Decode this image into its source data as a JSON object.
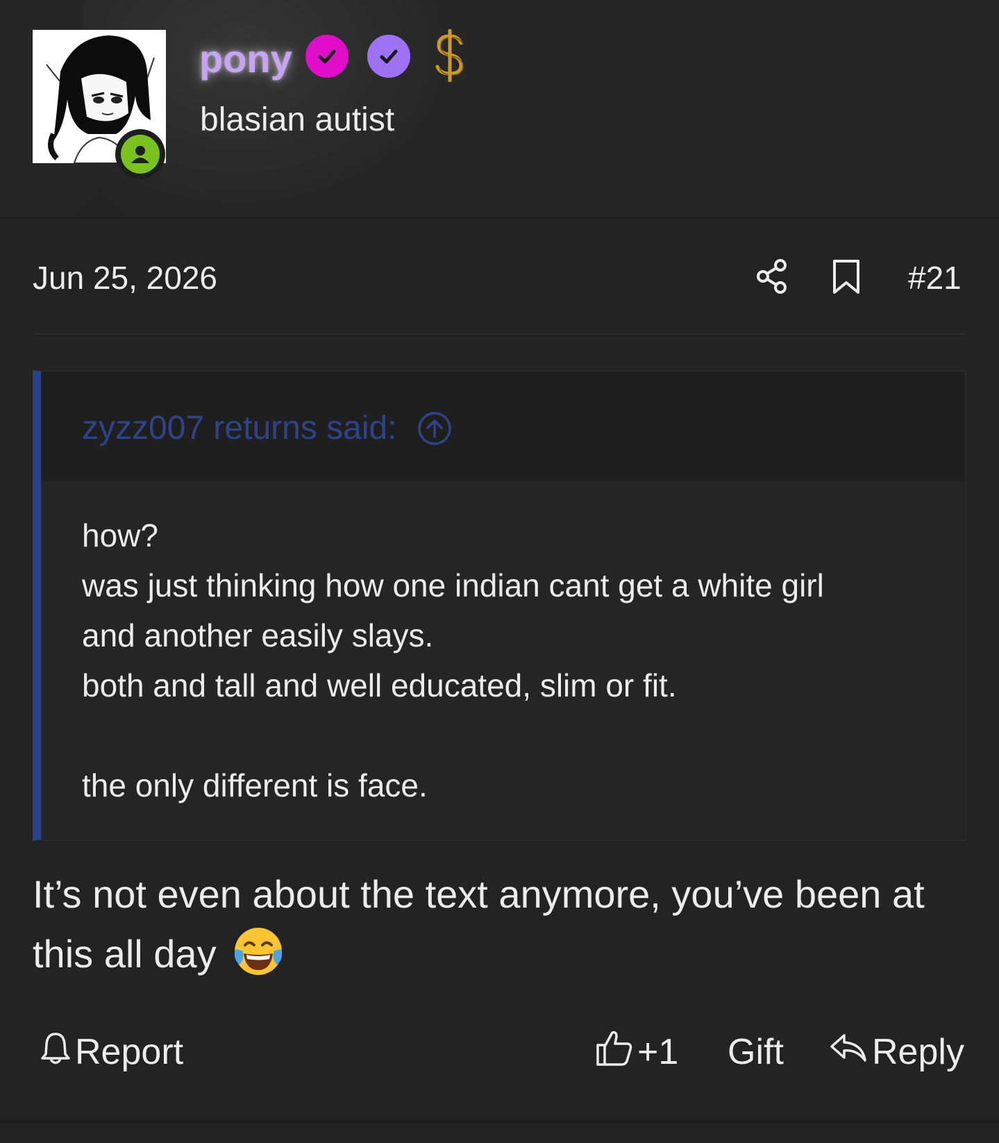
{
  "post": {
    "user": {
      "name": "pony",
      "title": "blasian autist",
      "name_color": "#c7a4f2",
      "badges": [
        {
          "name": "verified-pink",
          "color": "#e20dca"
        },
        {
          "name": "verified-purple",
          "color": "#9d72f5"
        },
        {
          "name": "dollar-supporter",
          "color": "#c89b2a"
        }
      ],
      "online_status_color": "#7ac21d"
    },
    "date": "Jun 25, 2026",
    "number": "#21",
    "quote": {
      "author_line": "zyzz007 returns said:",
      "accent_color": "#2b4289",
      "lines": [
        "how?",
        "was just thinking how one indian cant get a white girl",
        "and another easily slays.",
        "both and tall and well educated, slim or fit.",
        "",
        "the only different is face."
      ]
    },
    "message": "It’s not even about the text anymore, you’ve been at this all day",
    "message_emoji": "face-with-tears-of-joy"
  },
  "actions": {
    "report": "Report",
    "like_count": "+1",
    "gift": "Gift",
    "reply": "Reply"
  }
}
